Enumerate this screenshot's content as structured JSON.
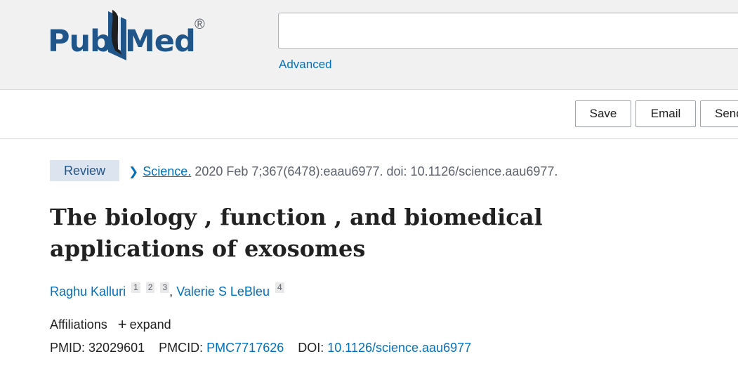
{
  "header": {
    "logo": {
      "text_left": "Pub",
      "text_right": "Med",
      "registered": "®",
      "book_color": "#1f1f1f",
      "brand_color": "#20558a"
    },
    "search": {
      "value": "",
      "placeholder": ""
    },
    "advanced_label": "Advanced"
  },
  "toolbar": {
    "save_label": "Save",
    "email_label": "Email",
    "send_label": "Send to"
  },
  "article": {
    "type_badge": "Review",
    "citation": {
      "journal": "Science.",
      "details": "2020 Feb 7;367(6478):eaau6977. doi: 10.1126/science.aau6977."
    },
    "title": "The biology , function , and biomedical applications of exosomes",
    "authors": [
      {
        "name": "Raghu Kalluri",
        "affiliations": [
          "1",
          "2",
          "3"
        ]
      },
      {
        "name": "Valerie S LeBleu",
        "affiliations": [
          "4"
        ]
      }
    ],
    "author_separator": ",",
    "affiliations_label": "Affiliations",
    "expand_label": "expand",
    "ids": {
      "pmid_label": "PMID:",
      "pmid": "32029601",
      "pmcid_label": "PMCID:",
      "pmcid": "PMC7717626",
      "doi_label": "DOI:",
      "doi": "10.1126/science.aau6977"
    }
  },
  "colors": {
    "link": "#0071bc",
    "header_bg": "#f1f1f1",
    "badge_bg": "#dce4ef"
  }
}
